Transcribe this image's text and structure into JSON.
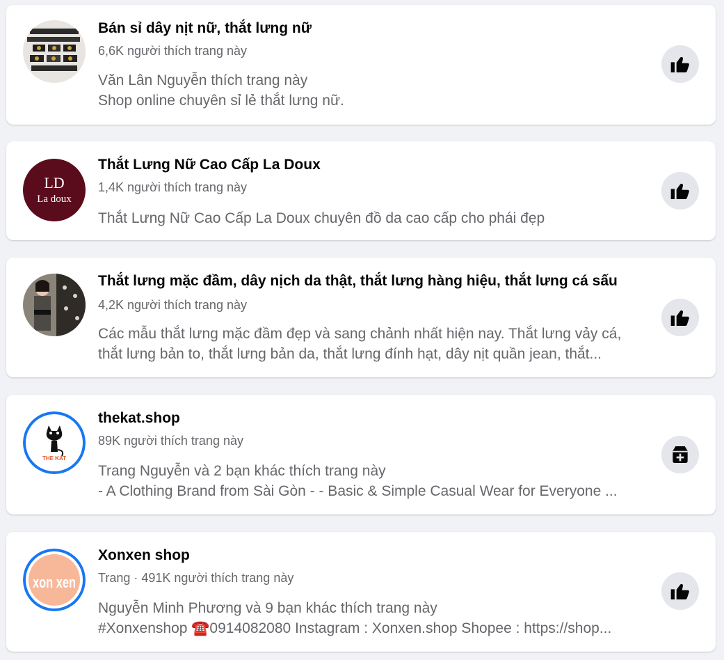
{
  "pages": [
    {
      "title": "Bán sỉ dây nịt nữ, thắt lưng nữ",
      "meta": "6,6K người thích trang này",
      "lines": [
        "Văn Lân Nguyễn thích trang này",
        "Shop online chuyên sỉ lẻ thắt lưng nữ."
      ],
      "action_icon": "like-icon"
    },
    {
      "title": "Thắt Lưng Nữ Cao Cấp La Doux",
      "meta": "1,4K người thích trang này",
      "lines": [
        "Thắt Lưng Nữ Cao Cấp La Doux chuyên đồ da cao cấp cho phái đẹp"
      ],
      "avatar_text": "La doux",
      "avatar_monogram": "LD",
      "action_icon": "like-icon"
    },
    {
      "title": "Thắt lưng mặc đầm, dây nịch da thật, thắt lưng hàng hiệu, thắt lưng cá sấu",
      "meta": "4,2K người thích trang này",
      "lines": [
        "Các mẫu thắt lưng mặc đầm đẹp và sang chảnh nhất hiện nay. Thắt lưng vảy cá,",
        "thắt lưng bản to, thắt lưng bản da, thắt lưng đính hạt, dây nịt quần jean, thắt..."
      ],
      "action_icon": "like-icon"
    },
    {
      "title": "thekat.shop",
      "meta": "89K người thích trang này",
      "lines": [
        "Trang Nguyễn và 2 bạn khác thích trang này",
        "- A Clothing Brand from Sài Gòn - - Basic & Simple Casual Wear for Everyone ..."
      ],
      "avatar_text": "THE KAT",
      "action_icon": "add-page-icon"
    },
    {
      "title": "Xonxen shop",
      "meta": "Trang · 491K người thích trang này",
      "lines": [
        "Nguyễn Minh Phương và 9 bạn khác thích trang này",
        "#Xonxenshop ☎️0914082080 Instagram : Xonxen.shop Shopee : https://shop..."
      ],
      "avatar_text": "xon xen",
      "action_icon": "like-icon"
    }
  ],
  "colors": {
    "background": "#f0f2f5",
    "card": "#ffffff",
    "title": "#050505",
    "secondary": "#65676b",
    "button_bg": "#e4e6eb",
    "ring": "#1877f2",
    "ladoux": "#5a0c1c",
    "xonxen": "#f7b89a"
  }
}
